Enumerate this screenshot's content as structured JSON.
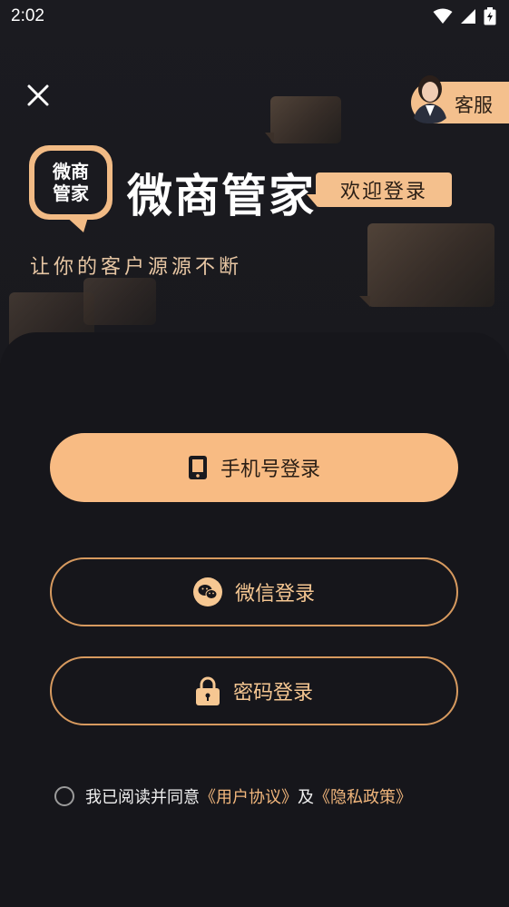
{
  "status_bar": {
    "time": "2:02"
  },
  "header": {
    "customer_service_label": "客服"
  },
  "brand": {
    "logo_line1": "微商",
    "logo_line2": "管家",
    "title": "微商管家",
    "welcome": "欢迎登录",
    "tagline": "让你的客户源源不断"
  },
  "login": {
    "phone_label": "手机号登录",
    "wechat_label": "微信登录",
    "password_label": "密码登录"
  },
  "agreement": {
    "prefix": "我已阅读并同意",
    "user_agreement": "《用户协议》",
    "conjunction": "及",
    "privacy_policy": "《隐私政策》"
  },
  "colors": {
    "accent": "#f8bb83",
    "background": "#16161b",
    "outline": "#d79a5f"
  },
  "icons": {
    "close": "close-icon",
    "phone": "phone-icon",
    "wechat": "wechat-icon",
    "lock": "lock-icon",
    "wifi": "wifi-icon",
    "signal": "signal-icon",
    "battery": "battery-icon"
  }
}
